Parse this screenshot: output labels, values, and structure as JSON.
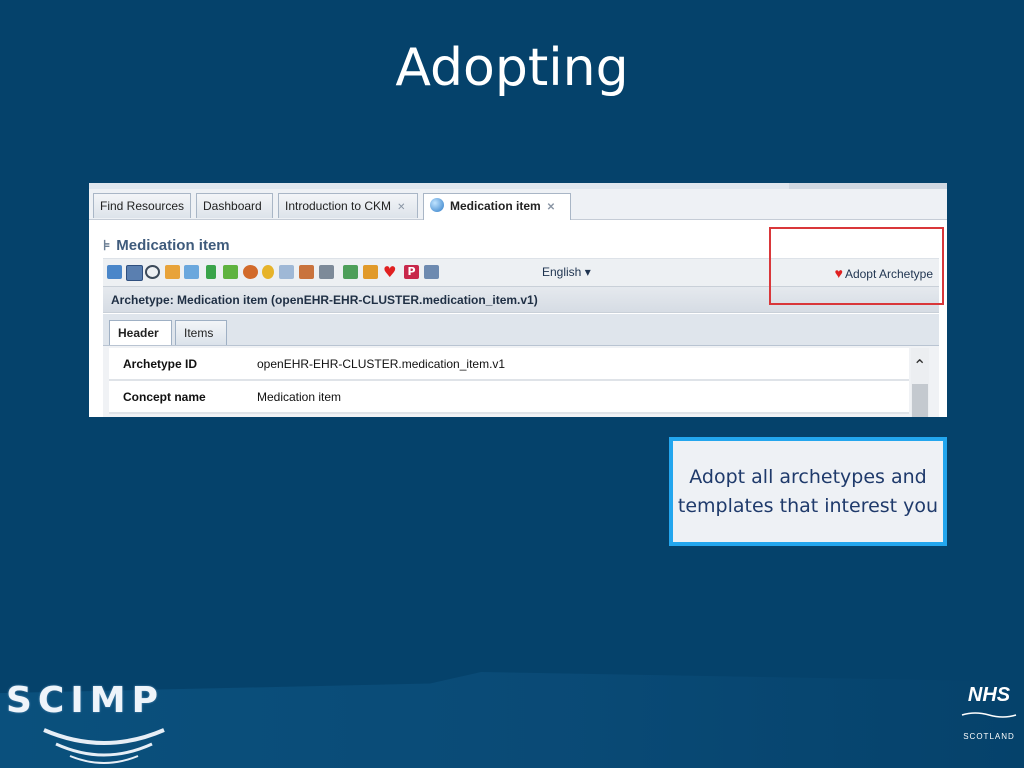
{
  "slide": {
    "title": "Adopting"
  },
  "tabs": [
    {
      "label": "Find Resources"
    },
    {
      "label": "Dashboard"
    },
    {
      "label": "Introduction to CKM"
    },
    {
      "label": "Medication item"
    }
  ],
  "panel": {
    "title": "Medication item",
    "toolbar": {
      "language": "English",
      "adopt_label": "Adopt Archetype"
    },
    "archetype_bar": "Archetype: Medication item (openEHR-EHR-CLUSTER.medication_item.v1)",
    "subtabs": [
      {
        "label": "Header"
      },
      {
        "label": "Items"
      }
    ],
    "rows": [
      {
        "key": "Archetype ID",
        "value": "openEHR-EHR-CLUSTER.medication_item.v1"
      },
      {
        "key": "Concept name",
        "value": "Medication item"
      }
    ]
  },
  "callout": {
    "text": "Adopt all archetypes and templates that interest you"
  },
  "footer": {
    "scimp_logo": "SCIMP",
    "nhs_logo": "NHS",
    "nhs_sub": "SCOTLAND"
  },
  "colors": {
    "background": "#05426b",
    "highlight": "#d9373a",
    "callout_border": "#23a6ee",
    "heart": "#e02020"
  }
}
